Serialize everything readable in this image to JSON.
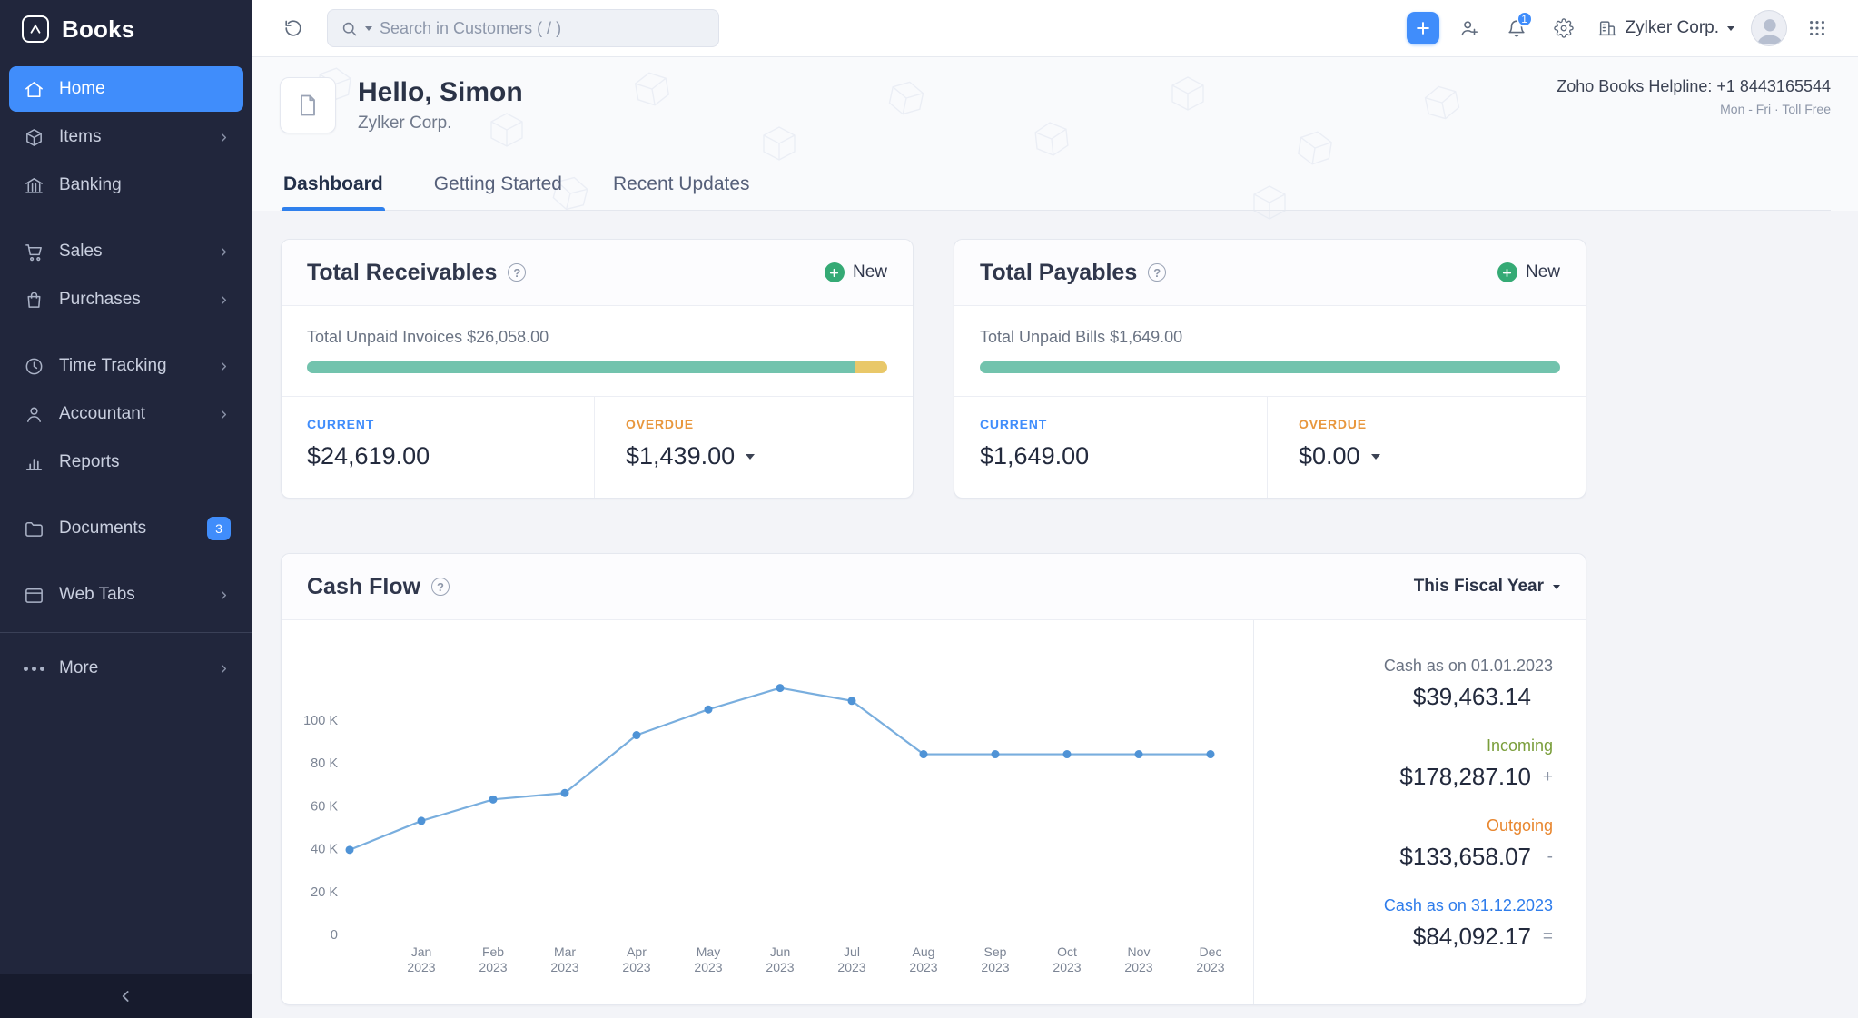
{
  "app": {
    "brand": "Books"
  },
  "icons": {
    "collapse": "‹"
  },
  "colors": {
    "primary": "#408dfb",
    "sidebar_bg": "#21263c",
    "progress_teal": "#72c3ad",
    "progress_yellow": "#e9c869",
    "overdue_orange": "#e8973d",
    "incoming_green": "#7a9e3b",
    "outgoing_orange": "#e8862e",
    "link_blue": "#2e7ceb",
    "chart_line": "#79aede",
    "chart_dot": "#4f93d6"
  },
  "sidebar": {
    "items": [
      {
        "label": "Home",
        "active": true
      },
      {
        "label": "Items",
        "expandable": true
      },
      {
        "label": "Banking"
      },
      {
        "label": "Sales",
        "expandable": true
      },
      {
        "label": "Purchases",
        "expandable": true
      },
      {
        "label": "Time Tracking",
        "expandable": true
      },
      {
        "label": "Accountant",
        "expandable": true
      },
      {
        "label": "Reports"
      },
      {
        "label": "Documents",
        "badge": "3"
      },
      {
        "label": "Web Tabs",
        "expandable": true
      },
      {
        "label": "More",
        "expandable": true
      }
    ]
  },
  "topbar": {
    "search_placeholder": "Search in Customers ( / )",
    "org": "Zylker Corp.",
    "notification_count": "1"
  },
  "header": {
    "greeting": "Hello, Simon",
    "org": "Zylker Corp.",
    "helpline": "Zoho Books Helpline: +1 8443165544",
    "helpline_sub": "Mon - Fri · Toll Free"
  },
  "tabs": [
    {
      "label": "Dashboard",
      "active": true
    },
    {
      "label": "Getting Started"
    },
    {
      "label": "Recent Updates"
    }
  ],
  "receivables": {
    "title": "Total Receivables",
    "new_label": "New",
    "total_label": "Total Unpaid Invoices $26,058.00",
    "current_label": "CURRENT",
    "current_value": "$24,619.00",
    "overdue_label": "OVERDUE",
    "overdue_value": "$1,439.00",
    "progress": {
      "current_pct": 94.5,
      "overdue_pct": 5.5
    }
  },
  "payables": {
    "title": "Total Payables",
    "new_label": "New",
    "total_label": "Total Unpaid Bills $1,649.00",
    "current_label": "CURRENT",
    "current_value": "$1,649.00",
    "overdue_label": "OVERDUE",
    "overdue_value": "$0.00",
    "progress": {
      "current_pct": 100,
      "overdue_pct": 0
    }
  },
  "cashflow": {
    "title": "Cash Flow",
    "period": "This Fiscal Year",
    "stats": [
      {
        "label": "Cash as on 01.01.2023",
        "value": "$39,463.14",
        "op": ""
      },
      {
        "label": "Incoming",
        "value": "$178,287.10",
        "op": "+"
      },
      {
        "label": "Outgoing",
        "value": "$133,658.07",
        "op": "-"
      },
      {
        "label": "Cash as on 31.12.2023",
        "value": "$84,092.17",
        "op": "="
      }
    ]
  },
  "chart_data": {
    "type": "line",
    "title": "Cash Flow",
    "opening_balance": 39463,
    "categories": [
      "Jan 2023",
      "Feb 2023",
      "Mar 2023",
      "Apr 2023",
      "May 2023",
      "Jun 2023",
      "Jul 2023",
      "Aug 2023",
      "Sep 2023",
      "Oct 2023",
      "Nov 2023",
      "Dec 2023"
    ],
    "monthly_values": [
      53000,
      63000,
      66000,
      93000,
      105000,
      115000,
      109000,
      84092,
      84092,
      84092,
      84092,
      84092
    ],
    "ylim": [
      0,
      120000
    ],
    "yticks": [
      {
        "value": 0,
        "label": "0"
      },
      {
        "value": 20000,
        "label": "20 K"
      },
      {
        "value": 40000,
        "label": "40 K"
      },
      {
        "value": 60000,
        "label": "60 K"
      },
      {
        "value": 80000,
        "label": "80 K"
      },
      {
        "value": 100000,
        "label": "100 K"
      }
    ],
    "grid": false,
    "legend": "none"
  }
}
